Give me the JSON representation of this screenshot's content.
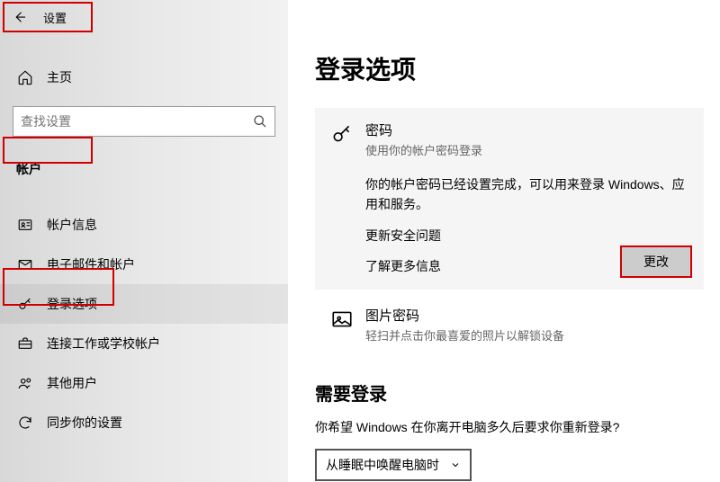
{
  "titlebar": {
    "title": "设置"
  },
  "home_label": "主页",
  "search": {
    "placeholder": "查找设置"
  },
  "category_label": "帐户",
  "nav": {
    "items": [
      {
        "label": "帐户信息"
      },
      {
        "label": "电子邮件和帐户"
      },
      {
        "label": "登录选项"
      },
      {
        "label": "连接工作或学校帐户"
      },
      {
        "label": "其他用户"
      },
      {
        "label": "同步你的设置"
      }
    ]
  },
  "page_title": "登录选项",
  "password_option": {
    "title": "密码",
    "subtitle": "使用你的帐户密码登录",
    "body": "你的帐户密码已经设置完成，可以用来登录 Windows、应用和服务。",
    "link1": "更新安全问题",
    "link2": "了解更多信息",
    "change_label": "更改"
  },
  "picture_option": {
    "title": "图片密码",
    "subtitle": "轻扫并点击你最喜爱的照片以解锁设备"
  },
  "require_signin": {
    "heading": "需要登录",
    "question": "你希望 Windows 在你离开电脑多久后要求你重新登录?",
    "selected": "从睡眠中唤醒电脑时"
  }
}
